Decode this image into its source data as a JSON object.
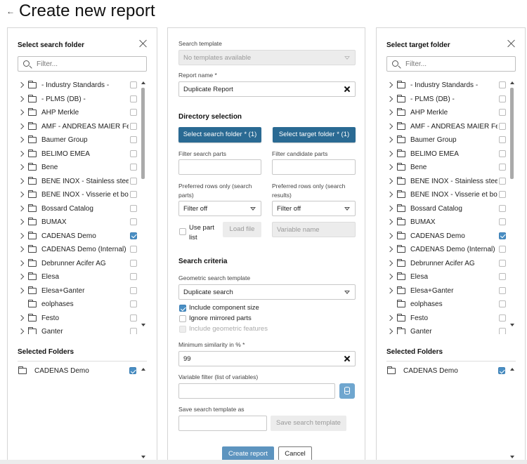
{
  "page": {
    "back_symbol": "←",
    "title": "Create new report"
  },
  "left_panel": {
    "title": "Select search folder",
    "filter_placeholder": "Filter...",
    "items": [
      {
        "label": "- Industry Standards -",
        "expandable": true,
        "checked": false
      },
      {
        "label": "- PLMS (DB) -",
        "expandable": true,
        "checked": false
      },
      {
        "label": "AHP Merkle",
        "expandable": true,
        "checked": false
      },
      {
        "label": "AMF - ANDREAS MAIER Fe...",
        "expandable": true,
        "checked": false
      },
      {
        "label": "Baumer Group",
        "expandable": true,
        "checked": false
      },
      {
        "label": "BELIMO EMEA",
        "expandable": true,
        "checked": false
      },
      {
        "label": "Bene",
        "expandable": true,
        "checked": false
      },
      {
        "label": "BENE INOX - Stainless stee...",
        "expandable": true,
        "checked": false
      },
      {
        "label": "BENE INOX - Visserie et bo...",
        "expandable": true,
        "checked": false
      },
      {
        "label": "Bossard Catalog",
        "expandable": true,
        "checked": false
      },
      {
        "label": "BUMAX",
        "expandable": true,
        "checked": false
      },
      {
        "label": "CADENAS Demo",
        "expandable": true,
        "checked": true
      },
      {
        "label": "CADENAS Demo (Internal)",
        "expandable": true,
        "checked": false
      },
      {
        "label": "Debrunner Acifer AG",
        "expandable": true,
        "checked": false
      },
      {
        "label": "Elesa",
        "expandable": true,
        "checked": false
      },
      {
        "label": "Elesa+Ganter",
        "expandable": true,
        "checked": false
      },
      {
        "label": "eolphases",
        "expandable": false,
        "checked": false
      },
      {
        "label": "Festo",
        "expandable": true,
        "checked": false
      },
      {
        "label": "Ganter",
        "expandable": true,
        "checked": false
      }
    ],
    "selected_title": "Selected Folders",
    "selected": [
      {
        "label": "CADENAS Demo",
        "checked": true
      }
    ]
  },
  "right_panel": {
    "title": "Select target folder",
    "filter_placeholder": "Filter...",
    "items": [
      {
        "label": "- Industry Standards -",
        "expandable": true,
        "checked": false
      },
      {
        "label": "- PLMS (DB) -",
        "expandable": true,
        "checked": false
      },
      {
        "label": "AHP Merkle",
        "expandable": true,
        "checked": false
      },
      {
        "label": "AMF - ANDREAS MAIER Fe...",
        "expandable": true,
        "checked": false
      },
      {
        "label": "Baumer Group",
        "expandable": true,
        "checked": false
      },
      {
        "label": "BELIMO EMEA",
        "expandable": true,
        "checked": false
      },
      {
        "label": "Bene",
        "expandable": true,
        "checked": false
      },
      {
        "label": "BENE INOX - Stainless stee...",
        "expandable": true,
        "checked": false
      },
      {
        "label": "BENE INOX - Visserie et bo...",
        "expandable": true,
        "checked": false
      },
      {
        "label": "Bossard Catalog",
        "expandable": true,
        "checked": false
      },
      {
        "label": "BUMAX",
        "expandable": true,
        "checked": false
      },
      {
        "label": "CADENAS Demo",
        "expandable": true,
        "checked": true
      },
      {
        "label": "CADENAS Demo (Internal)",
        "expandable": true,
        "checked": false
      },
      {
        "label": "Debrunner Acifer AG",
        "expandable": true,
        "checked": false
      },
      {
        "label": "Elesa",
        "expandable": true,
        "checked": false
      },
      {
        "label": "Elesa+Ganter",
        "expandable": true,
        "checked": false
      },
      {
        "label": "eolphases",
        "expandable": false,
        "checked": false
      },
      {
        "label": "Festo",
        "expandable": true,
        "checked": false
      },
      {
        "label": "Ganter",
        "expandable": true,
        "checked": false
      }
    ],
    "selected_title": "Selected Folders",
    "selected": [
      {
        "label": "CADENAS Demo",
        "checked": true
      }
    ]
  },
  "middle": {
    "search_template_label": "Search template",
    "search_template_value": "No templates available",
    "report_name_label": "Report name *",
    "report_name_value": "Duplicate Report",
    "directory_heading": "Directory selection",
    "select_search_folder_btn": "Select search folder * (1)",
    "select_target_folder_btn": "Select target folder * (1)",
    "filter_search_parts_label": "Filter search parts",
    "filter_candidate_parts_label": "Filter candidate parts",
    "preferred_rows_search_label_1": "Preferred rows only (search",
    "preferred_rows_search_label_2": "parts)",
    "preferred_rows_results_label_1": "Preferred rows only (search",
    "preferred_rows_results_label_2": "results)",
    "filter_off_left": "Filter off",
    "filter_off_right": "Filter off",
    "use_part_list_1": "Use part",
    "use_part_list_2": "list",
    "load_file_btn": "Load file",
    "variable_name_placeholder": "Variable name",
    "search_criteria_heading": "Search criteria",
    "geometric_template_label": "Geometric search template",
    "geometric_template_value": "Duplicate search",
    "include_component_size": "Include component size",
    "ignore_mirrored_parts": "Ignore mirrored parts",
    "include_geometric_features": "Include geometric features",
    "min_similarity_label": "Minimum similarity in % *",
    "min_similarity_value": "99",
    "variable_filter_label": "Variable filter (list of variables)",
    "save_template_label": "Save search template as",
    "save_template_btn": "Save search template",
    "create_report_btn": "Create report",
    "cancel_btn": "Cancel"
  },
  "colors": {
    "primary_button": "#2a6a93",
    "checkbox_checked": "#4a8fc4",
    "create_button": "#5d94bf"
  }
}
